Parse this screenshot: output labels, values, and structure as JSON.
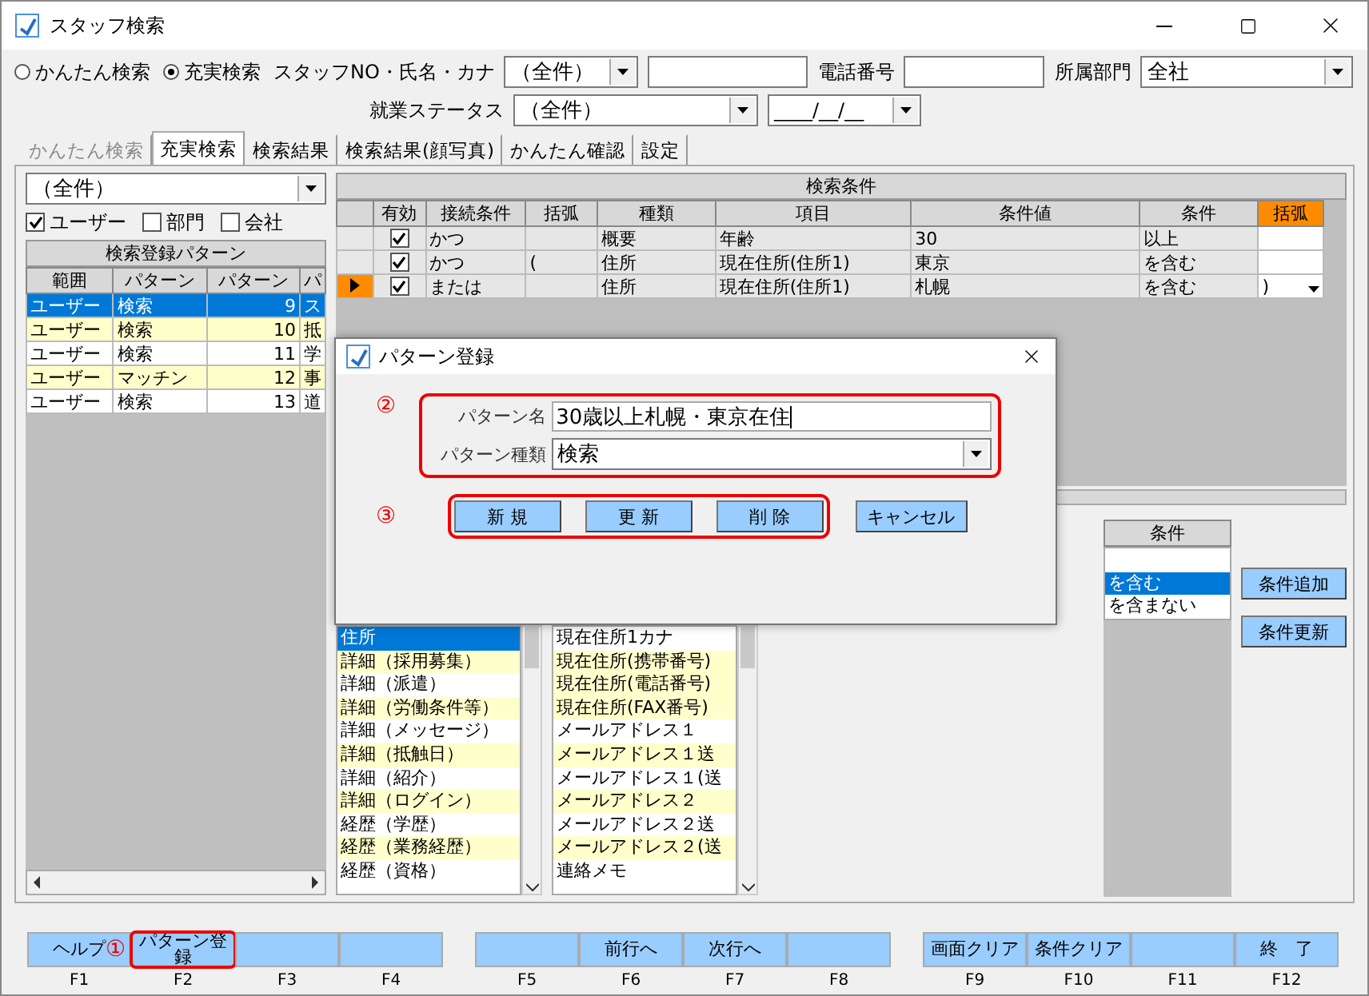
{
  "window": {
    "title": "スタッフ検索"
  },
  "search_mode": [
    {
      "label": "かんたん検索",
      "selected": false
    },
    {
      "label": "充実検索",
      "selected": true
    }
  ],
  "search": {
    "staff_label": "スタッフNO・氏名・カナ",
    "staff_select": "（全件）",
    "phone_label": "電話番号",
    "dept_label": "所属部門",
    "dept_select": "全社",
    "status_label": "就業ステータス",
    "status_select": "（全件）",
    "date": "____/__/__"
  },
  "tabs": [
    {
      "label": "かんたん検索",
      "selected": false,
      "disabled": true
    },
    {
      "label": "充実検索",
      "selected": true,
      "disabled": false
    },
    {
      "label": "検索結果",
      "selected": false,
      "disabled": false
    },
    {
      "label": "検索結果(顔写真)",
      "selected": false,
      "disabled": false
    },
    {
      "label": "かんたん確認",
      "selected": false,
      "disabled": false
    },
    {
      "label": "設定",
      "selected": false,
      "disabled": false
    }
  ],
  "pattern_panel": {
    "filter": "（全件）",
    "scopes": [
      {
        "label": "ユーザー",
        "checked": true
      },
      {
        "label": "部門",
        "checked": false
      },
      {
        "label": "会社",
        "checked": false
      }
    ],
    "title": "検索登録パターン",
    "columns": [
      "範囲",
      "パターン",
      "パターン",
      "パ"
    ],
    "rows": [
      {
        "cells": [
          "ユーザー",
          "検索",
          "9",
          "ス"
        ],
        "selected": true
      },
      {
        "cells": [
          "ユーザー",
          "検索",
          "10",
          "抵"
        ],
        "selected": false
      },
      {
        "cells": [
          "ユーザー",
          "検索",
          "11",
          "学"
        ],
        "selected": false
      },
      {
        "cells": [
          "ユーザー",
          "マッチン",
          "12",
          "事"
        ],
        "selected": false
      },
      {
        "cells": [
          "ユーザー",
          "検索",
          "13",
          "道"
        ],
        "selected": false
      }
    ]
  },
  "conditions": {
    "title": "検索条件",
    "enabled_header": "有効",
    "columns": [
      {
        "label": "接続条件",
        "highlighted": false
      },
      {
        "label": "括弧",
        "highlighted": false
      },
      {
        "label": "種類",
        "highlighted": false
      },
      {
        "label": "項目",
        "highlighted": false
      },
      {
        "label": "条件値",
        "highlighted": false
      },
      {
        "label": "条件",
        "highlighted": false
      },
      {
        "label": "括弧",
        "highlighted": true
      }
    ],
    "rows": [
      {
        "enabled": true,
        "current": false,
        "cells": [
          "かつ",
          "",
          "概要",
          "年齢",
          "30",
          "以上",
          ""
        ]
      },
      {
        "enabled": true,
        "current": false,
        "cells": [
          "かつ",
          "(",
          "住所",
          "現在住所(住所1)",
          "東京",
          "を含む",
          ""
        ]
      },
      {
        "enabled": true,
        "current": true,
        "cells": [
          "または",
          "",
          "住所",
          "現在住所(住所1)",
          "札幌",
          "を含む",
          ")"
        ]
      }
    ]
  },
  "kind_list": [
    {
      "label": "住所",
      "selected": true
    },
    {
      "label": "詳細（採用募集）",
      "selected": false,
      "shaded": true
    },
    {
      "label": "詳細（派遣）",
      "selected": false,
      "shaded": false
    },
    {
      "label": "詳細（労働条件等）",
      "selected": false,
      "shaded": true
    },
    {
      "label": "詳細（メッセージ）",
      "selected": false,
      "shaded": false
    },
    {
      "label": "詳細（抵触日）",
      "selected": false,
      "shaded": true
    },
    {
      "label": "詳細（紹介）",
      "selected": false,
      "shaded": false
    },
    {
      "label": "詳細（ログイン）",
      "selected": false,
      "shaded": true
    },
    {
      "label": "経歴（学歴）",
      "selected": false,
      "shaded": false
    },
    {
      "label": "経歴（業務経歴）",
      "selected": false,
      "shaded": true
    },
    {
      "label": "経歴（資格）",
      "selected": false,
      "shaded": false
    }
  ],
  "item_list": [
    {
      "label": "現在住所1カナ",
      "shaded": false
    },
    {
      "label": "現在住所(携帯番号)",
      "shaded": true
    },
    {
      "label": "現在住所(電話番号)",
      "shaded": true
    },
    {
      "label": "現在住所(FAX番号)",
      "shaded": true
    },
    {
      "label": "メールアドレス１",
      "shaded": false
    },
    {
      "label": "メールアドレス１送",
      "shaded": true
    },
    {
      "label": "メールアドレス１(送",
      "shaded": false
    },
    {
      "label": "メールアドレス２",
      "shaded": true
    },
    {
      "label": "メールアドレス２送",
      "shaded": false
    },
    {
      "label": "メールアドレス２(送",
      "shaded": true
    },
    {
      "label": "連絡メモ",
      "shaded": false
    }
  ],
  "condition_list": {
    "title": "条件",
    "items": [
      {
        "label": "を含む",
        "selected": true
      },
      {
        "label": "を含まない",
        "selected": false
      }
    ]
  },
  "condition_buttons": [
    "条件追加",
    "条件更新"
  ],
  "dialog": {
    "title": "パターン登録",
    "fields_marker": "②",
    "fields": [
      {
        "kind": "text",
        "label": "パターン名",
        "value": "30歳以上札幌・東京在住"
      },
      {
        "kind": "select",
        "label": "パターン種類",
        "value": "検索"
      }
    ],
    "buttons_marker": "③",
    "buttons": [
      "新 規",
      "更 新",
      "削 除"
    ],
    "cancel": "キャンセル"
  },
  "function_keys": [
    {
      "label": "ヘルプ",
      "key": "F1"
    },
    {
      "label": "パターン登録",
      "key": "F2",
      "marker": "①"
    },
    {
      "key": "F3"
    },
    {
      "key": "F4"
    },
    {
      "key": "F5"
    },
    {
      "label": "前行へ",
      "key": "F6"
    },
    {
      "label": "次行へ",
      "key": "F7"
    },
    {
      "key": "F8"
    },
    {
      "label": "画面クリア",
      "key": "F9"
    },
    {
      "label": "条件クリア",
      "key": "F10"
    },
    {
      "key": "F11"
    },
    {
      "label": "終　了",
      "key": "F12"
    }
  ]
}
